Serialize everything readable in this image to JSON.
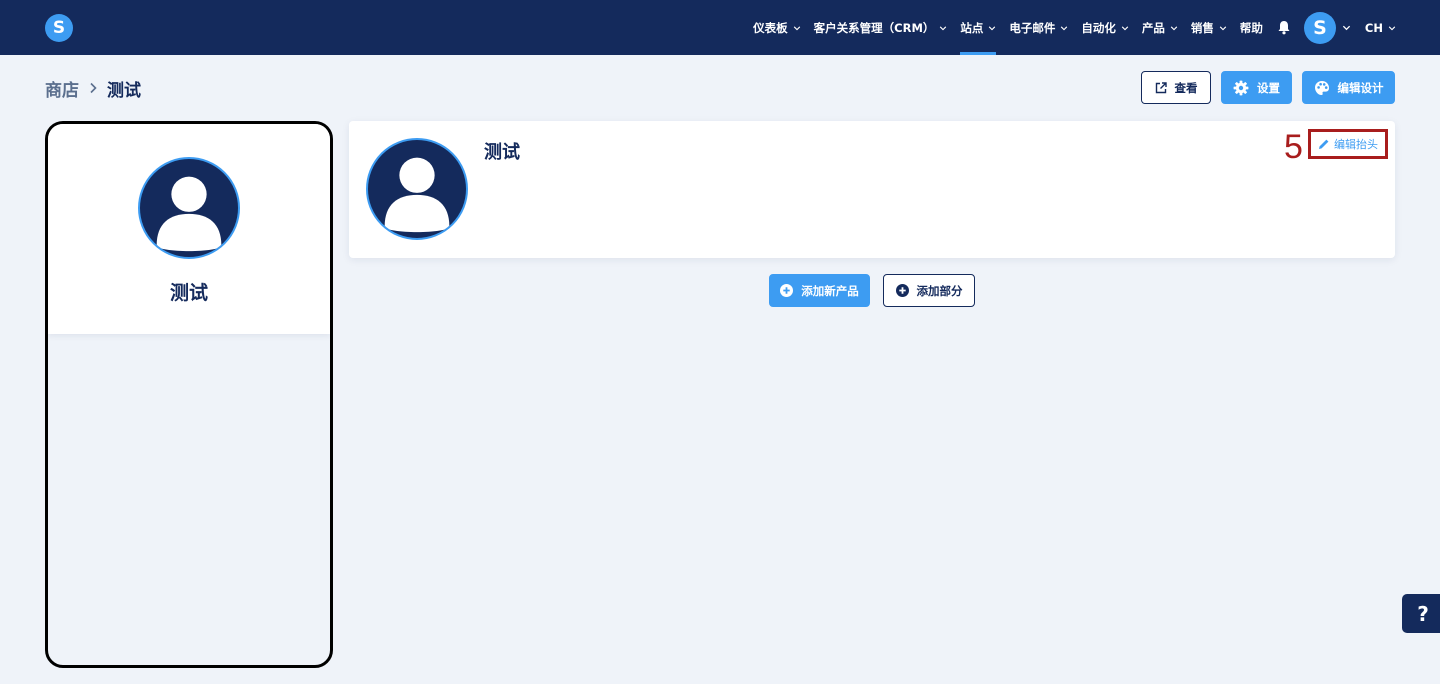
{
  "brand": {
    "logo_letter": "S",
    "accent_color": "#3d9cf2",
    "navy_color": "#142a5c"
  },
  "nav": {
    "items": [
      {
        "label": "仪表板",
        "has_dropdown": true,
        "active": false
      },
      {
        "label": "客户关系管理（CRM）",
        "has_dropdown": true,
        "active": false
      },
      {
        "label": "站点",
        "has_dropdown": true,
        "active": true
      },
      {
        "label": "电子邮件",
        "has_dropdown": true,
        "active": false
      },
      {
        "label": "自动化",
        "has_dropdown": true,
        "active": false
      },
      {
        "label": "产品",
        "has_dropdown": true,
        "active": false
      },
      {
        "label": "销售",
        "has_dropdown": true,
        "active": false
      },
      {
        "label": "帮助",
        "has_dropdown": false,
        "active": false
      }
    ],
    "notifications_icon": "bell-icon",
    "user_avatar_letter": "S",
    "language": "CH"
  },
  "breadcrumb": {
    "parent": "商店",
    "current": "测试"
  },
  "toolbar": {
    "view_label": "查看",
    "settings_label": "设置",
    "edit_design_label": "编辑设计"
  },
  "preview": {
    "title": "测试"
  },
  "header_card": {
    "title": "测试",
    "step_number": "5",
    "edit_header_label": "编辑抬头",
    "annotation_color": "#a81d1d"
  },
  "actions": {
    "add_product_label": "添加新产品",
    "add_section_label": "添加部分"
  },
  "help": {
    "label": "?"
  }
}
